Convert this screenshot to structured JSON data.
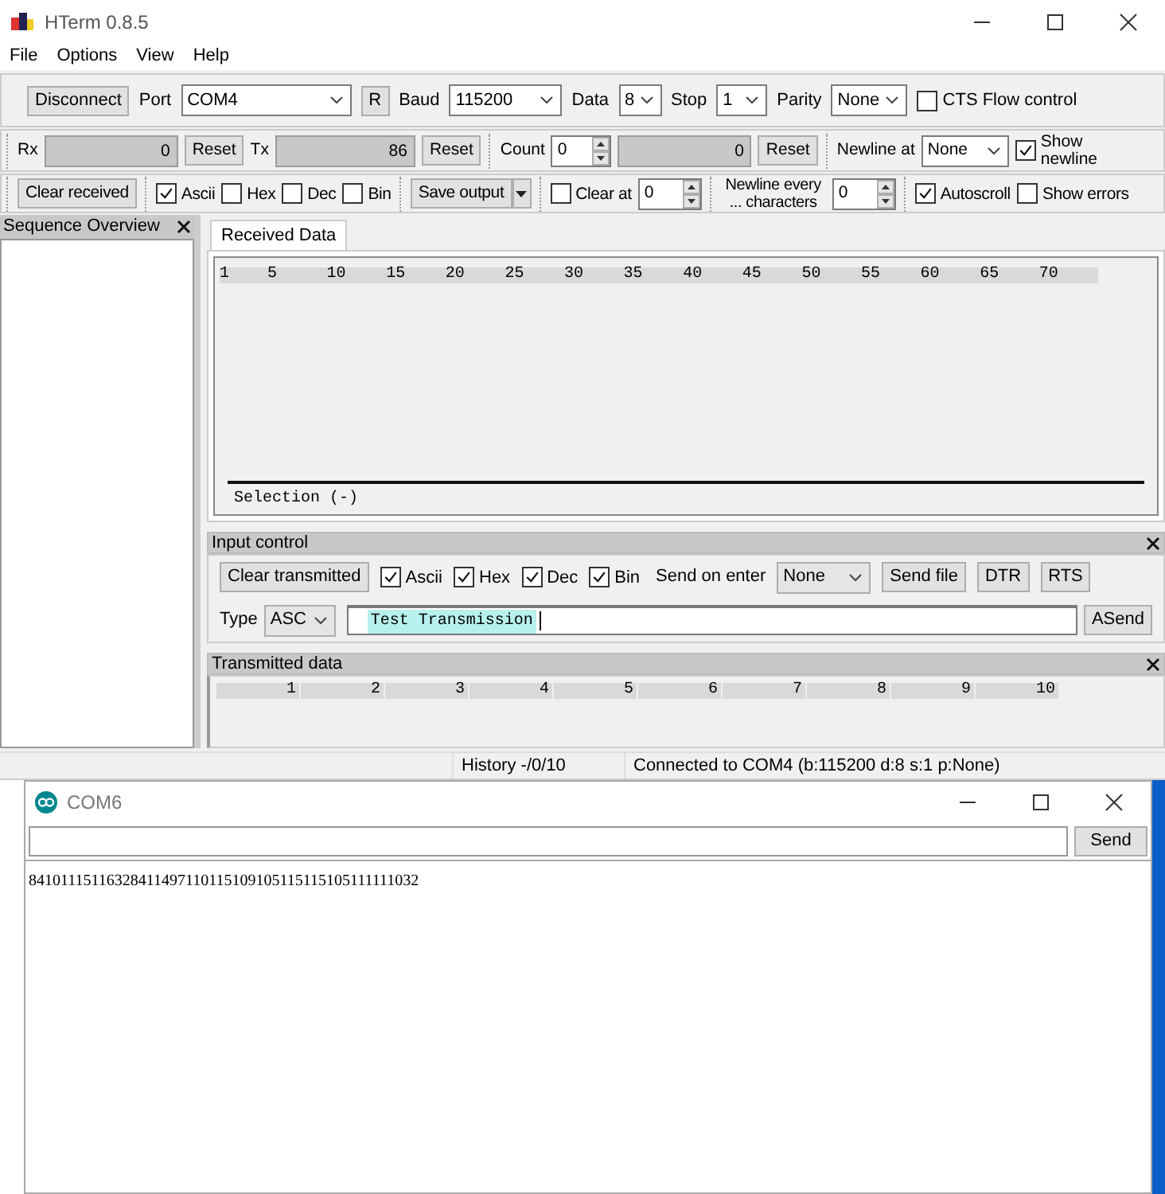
{
  "hterm": {
    "title": "HTerm 0.8.5",
    "menu": [
      "File",
      "Options",
      "View",
      "Help"
    ],
    "toolbar_rows": [
      [
        [
          {
            "kind": "button",
            "text": "Disconnect"
          },
          {
            "kind": "label",
            "text": "Port"
          },
          {
            "kind": "select",
            "text": "COM4"
          },
          {
            "kind": "button",
            "text": "R"
          },
          {
            "kind": "label",
            "text": "Baud"
          },
          {
            "kind": "select",
            "text": "115200"
          },
          {
            "kind": "label",
            "text": "Data"
          },
          {
            "kind": "select",
            "text": "8"
          },
          {
            "kind": "label",
            "text": "Stop"
          },
          {
            "kind": "select",
            "text": "1"
          },
          {
            "kind": "label",
            "text": "Parity"
          },
          {
            "kind": "select",
            "text": "None"
          },
          {
            "kind": "checkbox",
            "text": "CTS Flow control",
            "checked": false
          }
        ]
      ],
      [
        [
          {
            "kind": "label",
            "text": "Rx"
          },
          {
            "kind": "counter",
            "text": "0"
          },
          {
            "kind": "button",
            "text": "Reset"
          },
          {
            "kind": "label",
            "text": "Tx"
          },
          {
            "kind": "counter",
            "text": "86"
          },
          {
            "kind": "button",
            "text": "Reset"
          }
        ],
        [
          {
            "kind": "label",
            "text": "Count"
          },
          {
            "kind": "spinner",
            "text": "0"
          },
          {
            "kind": "counter",
            "text": "0"
          },
          {
            "kind": "button",
            "text": "Reset"
          }
        ],
        [
          {
            "kind": "label",
            "text": "Newline at"
          },
          {
            "kind": "select",
            "text": "None"
          },
          {
            "kind": "checkbox",
            "text": "Show newline",
            "checked": true
          }
        ]
      ],
      [
        [
          {
            "kind": "button",
            "text": "Clear received"
          }
        ],
        [
          {
            "kind": "checkbox",
            "text": "Ascii",
            "checked": true
          },
          {
            "kind": "checkbox",
            "text": "Hex",
            "checked": false
          },
          {
            "kind": "checkbox",
            "text": "Dec",
            "checked": false
          },
          {
            "kind": "checkbox",
            "text": "Bin",
            "checked": false
          }
        ],
        [
          {
            "kind": "splitbutton",
            "text": "Save output"
          }
        ],
        [
          {
            "kind": "checkbox",
            "text": "Clear at",
            "checked": false
          },
          {
            "kind": "spinner",
            "text": "0"
          }
        ],
        [
          {
            "kind": "label",
            "text": "Newline every ... characters"
          },
          {
            "kind": "spinner",
            "text": "0"
          }
        ],
        [
          {
            "kind": "checkbox",
            "text": "Autoscroll",
            "checked": true
          },
          {
            "kind": "checkbox",
            "text": "Show errors",
            "checked": false
          }
        ]
      ]
    ],
    "sidebar": {
      "title": "Sequence Overview"
    },
    "tabs": [
      {
        "label": "Received Data",
        "selected": true
      }
    ],
    "received_ruler": [
      "1",
      "5",
      "10",
      "15",
      "20",
      "25",
      "30",
      "35",
      "40",
      "45",
      "50",
      "55",
      "60",
      "65",
      "70"
    ],
    "selection": "Selection (-)",
    "input_control": {
      "title": "Input control",
      "row_1": [
        {
          "kind": "button",
          "text": "Clear transmitted"
        },
        {
          "kind": "checkbox",
          "text": "Ascii",
          "checked": true
        },
        {
          "kind": "checkbox",
          "text": "Hex",
          "checked": true
        },
        {
          "kind": "checkbox",
          "text": "Dec",
          "checked": true
        },
        {
          "kind": "checkbox",
          "text": "Bin",
          "checked": true
        },
        {
          "kind": "label",
          "text": "Send on enter"
        },
        {
          "kind": "select",
          "text": "None"
        },
        {
          "kind": "button",
          "text": "Send file"
        },
        {
          "kind": "button",
          "text": "DTR"
        },
        {
          "kind": "button",
          "text": "RTS"
        }
      ],
      "type_label": "Type",
      "type": "ASC",
      "input": {
        "value": "Test Transmission",
        "text_selected": true
      },
      "send": "ASend"
    },
    "transmitted_data": {
      "title": "Transmitted data",
      "ruler": [
        "1",
        "2",
        "3",
        "4",
        "5",
        "6",
        "7",
        "8",
        "9",
        "10"
      ]
    },
    "status_bar": [
      "History -/0/10",
      "Connected to COM4 (b:115200 d:8 s:1 p:None)"
    ]
  },
  "serial_monitor": {
    "title": "COM6",
    "send": "Send",
    "output": "84101115116328411497110115109105115115105111111032"
  }
}
